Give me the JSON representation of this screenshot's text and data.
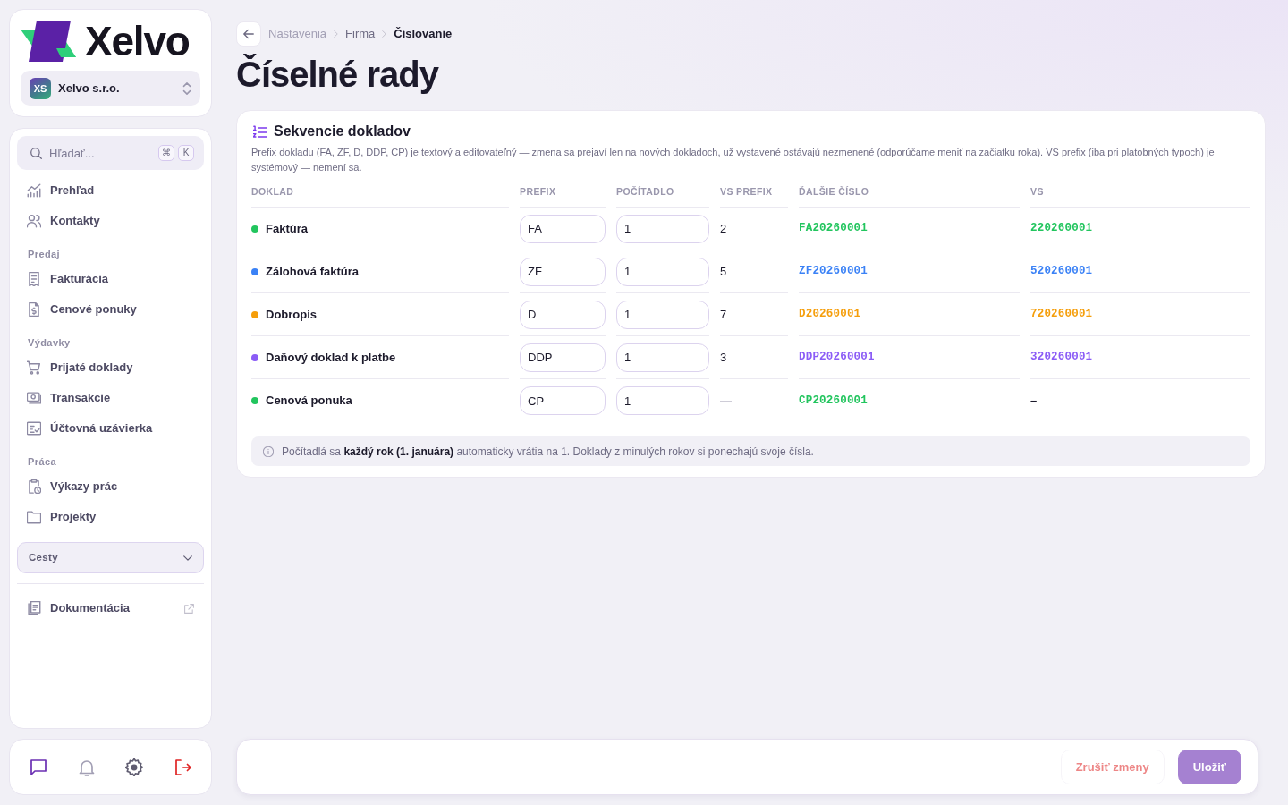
{
  "sidebar": {
    "logo": "Xelvo",
    "company": {
      "initials": "XS",
      "name": "Xelvo s.r.o."
    },
    "search": {
      "placeholder": "Hľadať...",
      "keys": [
        "⌘",
        "K"
      ]
    },
    "nav_groups": [
      {
        "items": [
          {
            "label": "Prehľad",
            "selected": false
          },
          {
            "label": "Kontakty",
            "selected": false
          }
        ]
      },
      {
        "heading": "Predaj",
        "items": [
          {
            "label": "Fakturácia",
            "selected": false
          },
          {
            "label": "Cenové ponuky",
            "selected": false
          }
        ]
      },
      {
        "heading": "Výdavky",
        "items": [
          {
            "label": "Prijaté doklady",
            "selected": false
          },
          {
            "label": "Transakcie",
            "selected": false
          },
          {
            "label": "Účtovná uzávierka",
            "selected": false
          }
        ]
      },
      {
        "heading": "Práca",
        "items": [
          {
            "label": "Výkazy prác",
            "selected": false
          },
          {
            "label": "Projekty",
            "selected": false
          }
        ]
      }
    ],
    "trip_group": {
      "label": "Cesty",
      "expanded": false
    },
    "docs_link": {
      "label": "Dokumentácia",
      "external": true
    },
    "bottom_bar": [
      {
        "kind": "chat"
      },
      {
        "kind": "notifications"
      },
      {
        "kind": "settings"
      },
      {
        "kind": "logout"
      }
    ]
  },
  "breadcrumb": [
    "Nastavenia",
    "Firma",
    "Číslovanie"
  ],
  "page_title": "Číselné rady",
  "section": {
    "title": "Sekvencie dokladov",
    "description": "Prefix dokladu (FA, ZF, D, DDP, CP) je textový a editovateľný — zmena sa prejaví len na nových dokladoch, už vystavené ostávajú nezmenené (odporúčame meniť na začiatku roka). VS prefix (iba pri platobných typoch) je systémový — nemení sa.",
    "table": {
      "columns": [
        "DOKLAD",
        "PREFIX",
        "POČÍTADLO",
        "VS PREFIX",
        "ĎALŠIE ČÍSLO",
        "VS"
      ],
      "rows": [
        {
          "name": "Faktúra",
          "color": "#22c55e",
          "prefix": "FA",
          "counter": "1",
          "vs_prefix": "2",
          "next_number": "FA20260001",
          "vs": "220260001",
          "payment_type": true
        },
        {
          "name": "Zálohová faktúra",
          "color": "#3b82f6",
          "prefix": "ZF",
          "counter": "1",
          "vs_prefix": "5",
          "next_number": "ZF20260001",
          "vs": "520260001",
          "payment_type": true
        },
        {
          "name": "Dobropis",
          "color": "#f59e0b",
          "prefix": "D",
          "counter": "1",
          "vs_prefix": "7",
          "next_number": "D20260001",
          "vs": "720260001",
          "payment_type": true
        },
        {
          "name": "Daňový doklad k platbe",
          "color": "#8b5cf6",
          "prefix": "DDP",
          "counter": "1",
          "vs_prefix": "3",
          "next_number": "DDP20260001",
          "vs": "320260001",
          "payment_type": true
        },
        {
          "name": "Cenová ponuka",
          "color": "#22c55e",
          "prefix": "CP",
          "counter": "1",
          "vs_prefix": "—",
          "next_number": "CP20260001",
          "vs": "–",
          "payment_type": false
        }
      ]
    },
    "note": "Počítadlá sa **každý rok (1. januára)** automaticky vrátia na 1. Doklady z minulých rokov si ponechajú svoje čísla."
  },
  "footer": {
    "buttons": [
      {
        "kind": "secondary",
        "label": "Zrušiť zmeny",
        "disabled": true
      },
      {
        "kind": "primary",
        "label": "Uložiť",
        "disabled": true
      }
    ]
  }
}
